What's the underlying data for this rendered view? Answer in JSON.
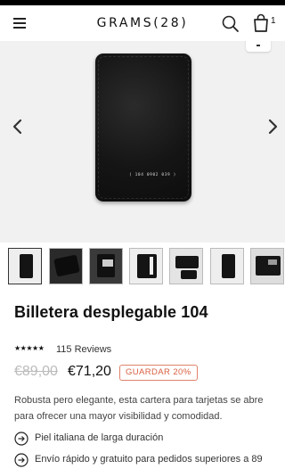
{
  "header": {
    "brand": "GRAMS(28)",
    "cart_count": "1"
  },
  "product": {
    "wallet_serial": "( 104  0902  039 )",
    "title": "Billetera desplegable 104",
    "rating": {
      "stars": "★★★★★",
      "reviews_label": "115 Reviews"
    },
    "price": {
      "old": "€89,00",
      "current": "€71,20",
      "save_badge": "GUARDAR 20%"
    },
    "description": "Robusta pero elegante, esta cartera para tarjetas se abre para ofrecer una mayor visibilidad y comodidad.",
    "features": [
      "Piel italiana de larga duración",
      "Envío rápido y gratuito para pedidos superiores a 89"
    ]
  },
  "gallery": {
    "thumbnail_count": 8,
    "selected_index": 0
  },
  "colors": {
    "accent_badge": "#d8603f",
    "hero_background": "#f1f1f1",
    "text": "#111111"
  }
}
